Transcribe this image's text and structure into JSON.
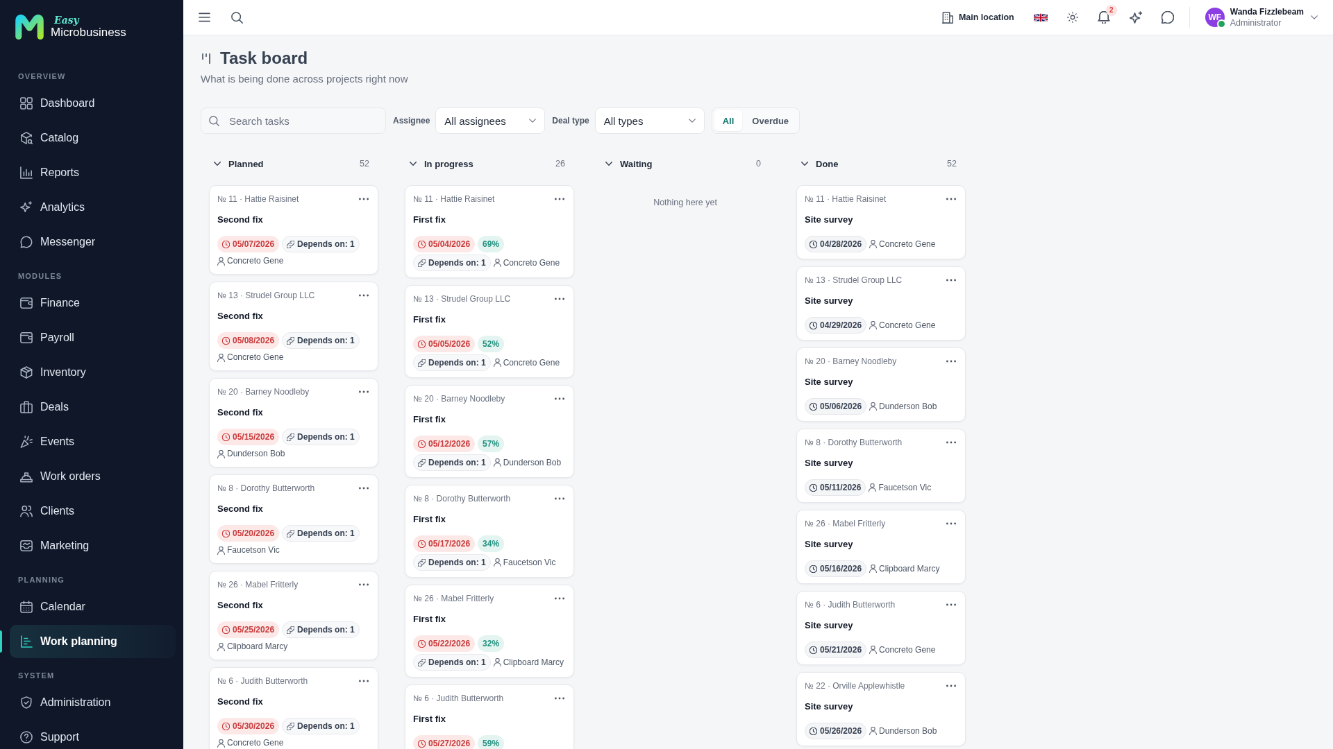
{
  "brand": {
    "prefix": "Easy",
    "name": "Microbusiness"
  },
  "sidebar": {
    "sections": [
      {
        "label": "OVERVIEW",
        "items": [
          {
            "label": "Dashboard",
            "selected": false
          },
          {
            "label": "Catalog",
            "selected": false
          },
          {
            "label": "Reports",
            "selected": false
          },
          {
            "label": "Analytics",
            "selected": false
          },
          {
            "label": "Messenger",
            "selected": false
          }
        ]
      },
      {
        "label": "MODULES",
        "items": [
          {
            "label": "Finance",
            "selected": false
          },
          {
            "label": "Payroll",
            "selected": false
          },
          {
            "label": "Inventory",
            "selected": false
          },
          {
            "label": "Deals",
            "selected": false
          },
          {
            "label": "Events",
            "selected": false
          },
          {
            "label": "Work orders",
            "selected": false
          },
          {
            "label": "Clients",
            "selected": false
          },
          {
            "label": "Marketing",
            "selected": false
          }
        ]
      },
      {
        "label": "PLANNING",
        "items": [
          {
            "label": "Calendar",
            "selected": false
          },
          {
            "label": "Work planning",
            "selected": true
          }
        ]
      },
      {
        "label": "SYSTEM",
        "items": [
          {
            "label": "Administration",
            "selected": false
          },
          {
            "label": "Support",
            "selected": false
          }
        ]
      }
    ]
  },
  "topbar": {
    "location": "Main location",
    "notifications": "2",
    "user": {
      "initials": "WF",
      "name": "Wanda Fizzlebeam",
      "role": "Administrator",
      "online": true
    }
  },
  "page": {
    "title": "Task board",
    "subtitle": "What is being done across projects right now"
  },
  "filters": {
    "search": {
      "placeholder": "Search tasks"
    },
    "selects": [
      {
        "label": "Assignee",
        "value": "All assignees"
      },
      {
        "label": "Deal type",
        "value": "All types"
      }
    ],
    "segments": [
      {
        "label": "All",
        "selected": true
      },
      {
        "label": "Overdue",
        "selected": false
      }
    ]
  },
  "columns": [
    {
      "title": "Planned",
      "count": "52",
      "cards": [
        {
          "ref": "№ 11 · Hattie Raisinet",
          "title": "Second fix",
          "date": "05/07/2026",
          "overdue": true,
          "depends": "Depends on: 1",
          "assignee": "Concreto Gene"
        },
        {
          "ref": "№ 13 · Strudel Group LLC",
          "title": "Second fix",
          "date": "05/08/2026",
          "overdue": true,
          "depends": "Depends on: 1",
          "assignee": "Concreto Gene"
        },
        {
          "ref": "№ 20 · Barney Noodleby",
          "title": "Second fix",
          "date": "05/15/2026",
          "overdue": true,
          "depends": "Depends on: 1",
          "assignee": "Dunderson Bob"
        },
        {
          "ref": "№ 8 · Dorothy Butterworth",
          "title": "Second fix",
          "date": "05/20/2026",
          "overdue": true,
          "depends": "Depends on: 1",
          "assignee": "Faucetson Vic"
        },
        {
          "ref": "№ 26 · Mabel Fritterly",
          "title": "Second fix",
          "date": "05/25/2026",
          "overdue": true,
          "depends": "Depends on: 1",
          "assignee": "Clipboard Marcy"
        },
        {
          "ref": "№ 6 · Judith Butterworth",
          "title": "Second fix",
          "date": "05/30/2026",
          "overdue": true,
          "depends": "Depends on: 1",
          "assignee": "Concreto Gene"
        }
      ]
    },
    {
      "title": "In progress",
      "count": "26",
      "cards": [
        {
          "ref": "№ 11 · Hattie Raisinet",
          "title": "First fix",
          "date": "05/04/2026",
          "overdue": true,
          "progress": "69%",
          "depends": "Depends on: 1",
          "assignee": "Concreto Gene"
        },
        {
          "ref": "№ 13 · Strudel Group LLC",
          "title": "First fix",
          "date": "05/05/2026",
          "overdue": true,
          "progress": "52%",
          "depends": "Depends on: 1",
          "assignee": "Concreto Gene"
        },
        {
          "ref": "№ 20 · Barney Noodleby",
          "title": "First fix",
          "date": "05/12/2026",
          "overdue": true,
          "progress": "57%",
          "depends": "Depends on: 1",
          "assignee": "Dunderson Bob"
        },
        {
          "ref": "№ 8 · Dorothy Butterworth",
          "title": "First fix",
          "date": "05/17/2026",
          "overdue": true,
          "progress": "34%",
          "depends": "Depends on: 1",
          "assignee": "Faucetson Vic"
        },
        {
          "ref": "№ 26 · Mabel Fritterly",
          "title": "First fix",
          "date": "05/22/2026",
          "overdue": true,
          "progress": "32%",
          "depends": "Depends on: 1",
          "assignee": "Clipboard Marcy"
        },
        {
          "ref": "№ 6 · Judith Butterworth",
          "title": "First fix",
          "date": "05/27/2026",
          "overdue": true,
          "progress": "59%"
        }
      ]
    },
    {
      "title": "Waiting",
      "count": "0",
      "empty_text": "Nothing here yet"
    },
    {
      "title": "Done",
      "count": "52",
      "cards": [
        {
          "ref": "№ 11 · Hattie Raisinet",
          "title": "Site survey",
          "date": "04/28/2026",
          "overdue": false,
          "assignee": "Concreto Gene"
        },
        {
          "ref": "№ 13 · Strudel Group LLC",
          "title": "Site survey",
          "date": "04/29/2026",
          "overdue": false,
          "assignee": "Concreto Gene"
        },
        {
          "ref": "№ 20 · Barney Noodleby",
          "title": "Site survey",
          "date": "05/06/2026",
          "overdue": false,
          "assignee": "Dunderson Bob"
        },
        {
          "ref": "№ 8 · Dorothy Butterworth",
          "title": "Site survey",
          "date": "05/11/2026",
          "overdue": false,
          "assignee": "Faucetson Vic"
        },
        {
          "ref": "№ 26 · Mabel Fritterly",
          "title": "Site survey",
          "date": "05/16/2026",
          "overdue": false,
          "assignee": "Clipboard Marcy"
        },
        {
          "ref": "№ 6 · Judith Butterworth",
          "title": "Site survey",
          "date": "05/21/2026",
          "overdue": false,
          "assignee": "Concreto Gene"
        },
        {
          "ref": "№ 22 · Orville Applewhistle",
          "title": "Site survey",
          "date": "05/26/2026",
          "overdue": false,
          "assignee": "Dunderson Bob"
        }
      ]
    }
  ]
}
